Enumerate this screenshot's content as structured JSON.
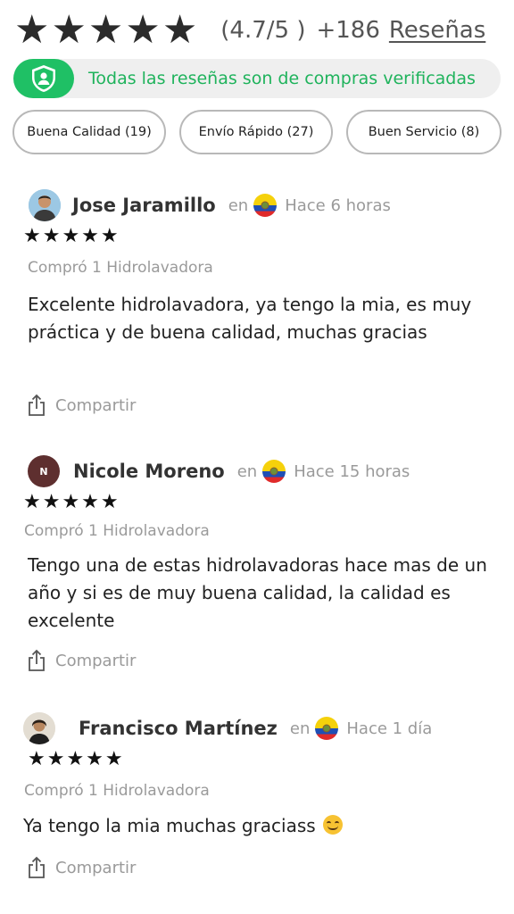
{
  "summary": {
    "star_glyph": "★",
    "stars_filled": 5,
    "score": "(4.7/5 )",
    "count": "+186",
    "reviews_link": "Reseñas"
  },
  "verified": {
    "text": "Todas las reseñas son de compras verificadas",
    "icon": "verified-user-shield-icon",
    "accent_color": "#1fc065"
  },
  "chips": [
    {
      "label": "Buena Calidad (19)"
    },
    {
      "label": "Envío Rápido (27)"
    },
    {
      "label": "Buen Servicio (8)"
    }
  ],
  "reviews": [
    {
      "name": "Jose Jaramillo",
      "avatar": "photo",
      "en": "en",
      "flag": "ecuador-flag-icon",
      "time": "Hace 6 horas",
      "stars": "★★★★★",
      "purchase": "Compró 1 Hidrolavadora",
      "text": "Excelente hidrolavadora, ya tengo la mia, es muy práctica y de buena calidad, muchas gracias",
      "share": "Compartir"
    },
    {
      "name": "Nicole Moreno",
      "avatar": "initial",
      "initial": "N",
      "en": "en",
      "flag": "ecuador-flag-icon",
      "time": "Hace 15 horas",
      "stars": "★★★★★",
      "purchase": "Compró 1 Hidrolavadora",
      "text": "Tengo una de estas hidrolavadoras hace mas de un año y si es de muy buena calidad, la calidad es excelente",
      "share": "Compartir"
    },
    {
      "name": "Francisco Martínez",
      "avatar": "photo",
      "en": "en",
      "flag": "ecuador-flag-icon",
      "time": "Hace 1 día",
      "stars": "★★★★★",
      "purchase": "Compró 1 Hidrolavadora",
      "text": "Ya tengo la mia muchas graciass",
      "emoji": "smiling-face-emoji",
      "share": "Compartir"
    }
  ]
}
